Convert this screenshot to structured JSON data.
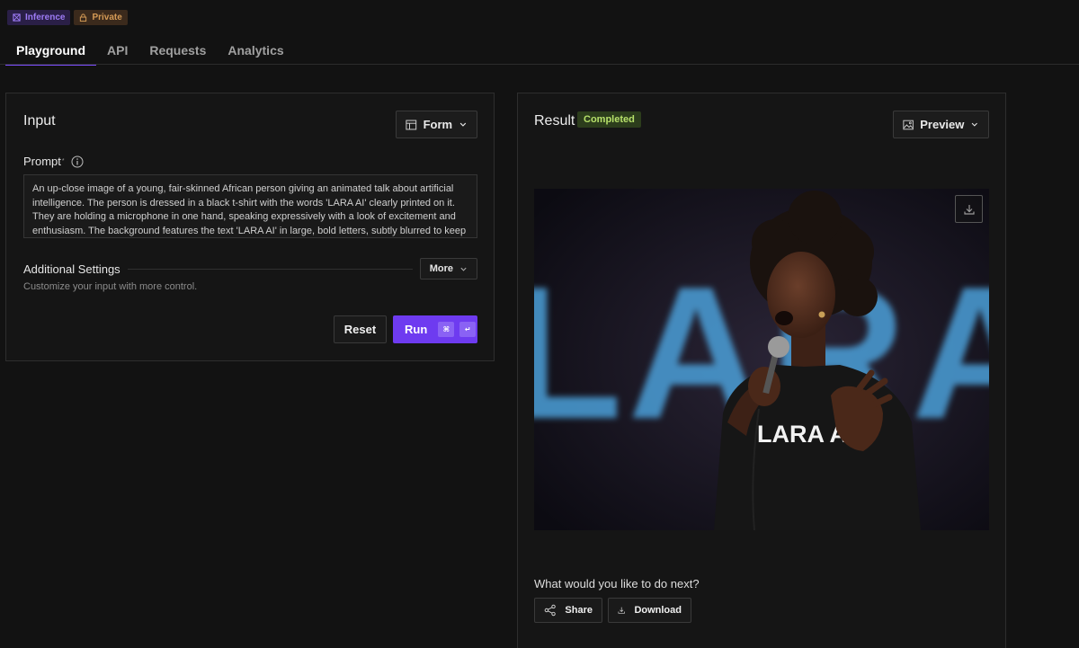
{
  "badges": {
    "inference": "Inference",
    "private": "Private"
  },
  "tabs": [
    {
      "label": "Playground",
      "active": true
    },
    {
      "label": "API",
      "active": false
    },
    {
      "label": "Requests",
      "active": false
    },
    {
      "label": "Analytics",
      "active": false
    }
  ],
  "input": {
    "title": "Input",
    "mode_label": "Form",
    "prompt_label": "Prompt",
    "prompt_required_mark": "*",
    "prompt_text": "An up-close image of a young, fair-skinned African person giving an animated talk about artificial intelligence. The person is dressed in a black t-shirt with the words 'LARA AI' clearly printed on it. They are holding a microphone in one hand, speaking expressively with a look of excitement and enthusiasm. The background features the text 'LARA AI' in large, bold letters, subtly blurred to keep",
    "settings_title": "Additional Settings",
    "settings_more": "More",
    "settings_sub": "Customize your input with more control.",
    "reset_label": "Reset",
    "run_label": "Run",
    "run_kbd_1": "⌘",
    "run_kbd_2": "↵"
  },
  "result": {
    "title": "Result",
    "status": "Completed",
    "status_color": "#b6e06a",
    "view_label": "Preview",
    "image_bg_text": "LARA AI",
    "image_shirt_text": "LARA AI",
    "next_question": "What would you like to do next?",
    "share_label": "Share",
    "download_label": "Download"
  },
  "colors": {
    "accent": "#6e3bf0",
    "tab_underline": "#7c4dff"
  }
}
